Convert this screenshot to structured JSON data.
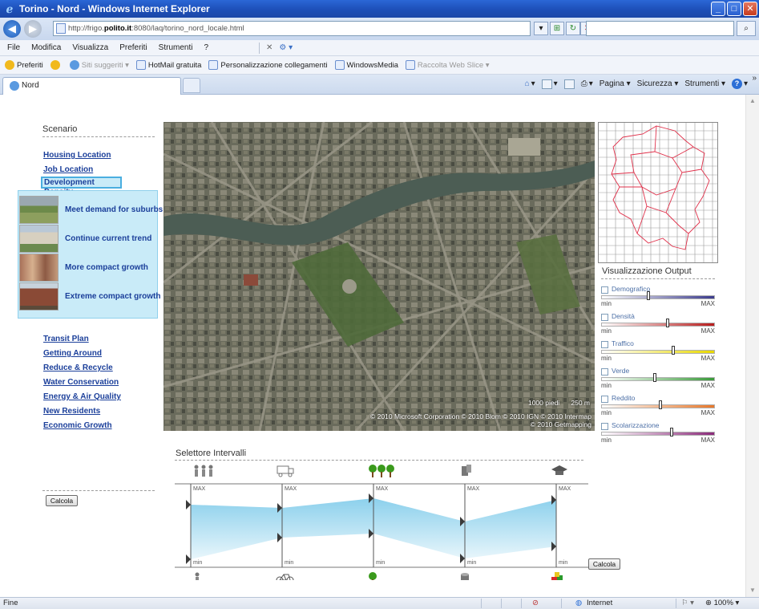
{
  "window": {
    "title": "Torino - Nord - Windows Internet Explorer",
    "min_glyph": "_",
    "max_glyph": "□",
    "close_glyph": "✕"
  },
  "address": {
    "url_prefix": "http://frigo.",
    "url_bold": "polito.it",
    "url_suffix": ":8080/laq/torino_nord_locale.html",
    "search_value": ""
  },
  "menu": {
    "items": [
      "File",
      "Modifica",
      "Visualizza",
      "Preferiti",
      "Strumenti",
      "?"
    ]
  },
  "favorites": {
    "label": "Preferiti",
    "items": [
      "Siti suggeriti ▾",
      "HotMail gratuita",
      "Personalizzazione collegamenti",
      "WindowsMedia",
      "Raccolta Web Slice ▾"
    ]
  },
  "tabs": {
    "active": "Nord"
  },
  "commands": {
    "pagina": "Pagina ▾",
    "sicurezza": "Sicurezza ▾",
    "strumenti": "Strumenti ▾",
    "more": "»"
  },
  "sidebar": {
    "title": "Scenario",
    "links_top": [
      "Housing Location",
      "Job Location"
    ],
    "selected": "Development Density",
    "density_options": [
      "Meet demand for suburbs",
      "Continue current trend",
      "More compact growth",
      "Extreme compact growth"
    ],
    "links_bottom": [
      "Transit Plan",
      "Getting Around",
      "Reduce & Recycle",
      "Water Conservation",
      "Energy & Air Quality",
      "New Residents",
      "Economic Growth"
    ],
    "calc_label": "Calcola"
  },
  "map": {
    "scale_feet": "1000 piedi",
    "scale_m": "250 m",
    "attribution_1": "© 2010 Microsoft Corporation   © 2010 Blom   © 2010 IGN   © 2010 Intermap",
    "attribution_2": "© 2010 Getmapping"
  },
  "output": {
    "title": "Visualizzazione Output",
    "min_label": "min",
    "max_label": "MAX",
    "indicators": [
      {
        "name": "Demografico",
        "level": 0.41,
        "color_a": "#ffffff",
        "color_b": "#3b3b8c"
      },
      {
        "name": "Densità",
        "level": 0.59,
        "color_a": "#ffffff",
        "color_b": "#b81c1c"
      },
      {
        "name": "Traffico",
        "level": 0.64,
        "color_a": "#ffffff",
        "color_b": "#e8d800"
      },
      {
        "name": "Verde",
        "level": 0.47,
        "color_a": "#ffffff",
        "color_b": "#3a9a3a"
      },
      {
        "name": "Reddito",
        "level": 0.52,
        "color_a": "#ffffff",
        "color_b": "#e8782a"
      },
      {
        "name": "Scolarizzazione",
        "level": 0.62,
        "color_a": "#ffffff",
        "color_b": "#8b2a7a"
      }
    ]
  },
  "selettore": {
    "title": "Selettore Intervalli",
    "max_label": "MAX",
    "min_label": "min",
    "columns": [
      {
        "top_icon": "people-icon",
        "bottom_icon": "pedestrian-icon",
        "upper": 0.76,
        "lower": 0.08
      },
      {
        "top_icon": "truck-icon",
        "bottom_icon": "bicycle-icon",
        "upper": 0.72,
        "lower": 0.35
      },
      {
        "top_icon": "trees-icon",
        "bottom_icon": "tree-icon",
        "upper": 0.84,
        "lower": 0.4
      },
      {
        "top_icon": "trash-bins-icon",
        "bottom_icon": "trash-bin-icon",
        "upper": 0.55,
        "lower": 0.09
      },
      {
        "top_icon": "graduation-cap-icon",
        "bottom_icon": "school-blocks-icon",
        "upper": 0.82,
        "lower": 0.24
      }
    ],
    "calc_label": "Calcola"
  },
  "status": {
    "left": "Fine",
    "zone": "Internet",
    "zoom": "100%"
  }
}
